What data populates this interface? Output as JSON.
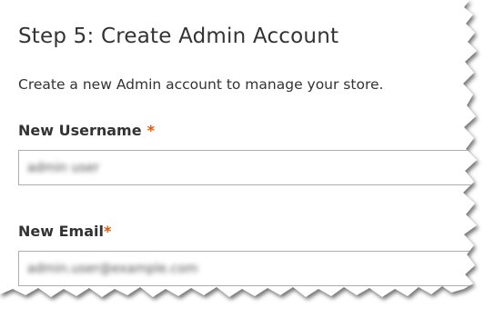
{
  "step": {
    "title": "Step 5: Create Admin Account",
    "description": "Create a new Admin account to manage your store."
  },
  "form": {
    "username": {
      "label": "New Username",
      "required_mark": "*",
      "value": "admin user"
    },
    "email": {
      "label": "New Email",
      "required_mark": "*",
      "value": "admin.user@example.com"
    }
  },
  "colors": {
    "text": "#333333",
    "required": "#eb5202",
    "input_border": "#adadad"
  }
}
